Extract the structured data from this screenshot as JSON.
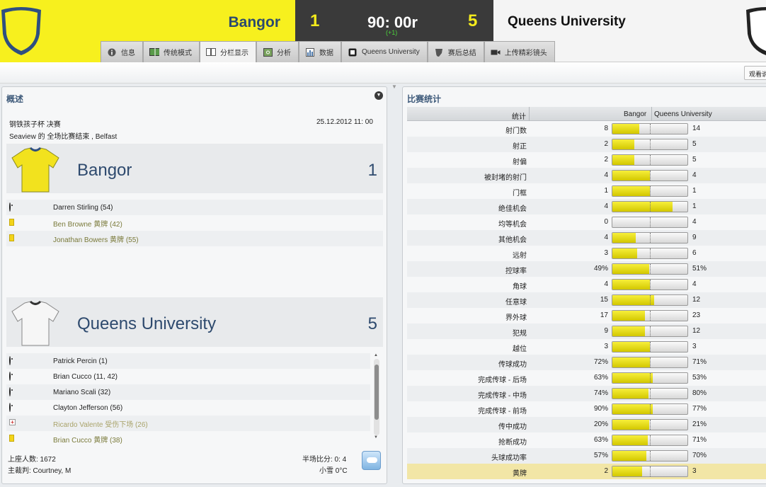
{
  "header": {
    "home_name": "Bangor",
    "away_name": "Queens University",
    "home_score": "1",
    "away_score": "5",
    "time": "90: 00r",
    "added_time": "(+1)",
    "home_color": "#f7f01e",
    "away_color": "#f4f4f4"
  },
  "tabs": [
    {
      "label": "信息",
      "icon": "info-icon"
    },
    {
      "label": "传统模式",
      "icon": "pitch-icon"
    },
    {
      "label": "分栏显示",
      "icon": "split-view-icon",
      "active": true
    },
    {
      "label": "分析",
      "icon": "analysis-icon"
    },
    {
      "label": "数据",
      "icon": "stats-icon"
    },
    {
      "label": "Queens University",
      "icon": "team-icon"
    },
    {
      "label": "赛后总结",
      "icon": "shield-icon"
    },
    {
      "label": "上传精彩镜头",
      "icon": "camera-icon"
    }
  ],
  "subbar": {
    "watch_label": "观看说"
  },
  "overview": {
    "title": "概述",
    "competition": "钢铁孩子杯 决赛",
    "date": "25.12.2012 11: 00",
    "result_line": "Seaview 的 全场比赛结束 , Belfast",
    "home": {
      "name": "Bangor",
      "goals": "1",
      "events": [
        {
          "type": "goal",
          "text": "Darren Stirling (54)"
        },
        {
          "type": "yellow",
          "text": "Ben Browne 黄牌 (42)"
        },
        {
          "type": "yellow",
          "text": "Jonathan Bowers 黄牌 (55)"
        }
      ]
    },
    "away": {
      "name": "Queens University",
      "goals": "5",
      "events": [
        {
          "type": "goal",
          "text": "Patrick Percin (1)"
        },
        {
          "type": "goal",
          "text": "Brian Cucco (11, 42)"
        },
        {
          "type": "goal",
          "text": "Mariano Scali (32)"
        },
        {
          "type": "goal",
          "text": "Clayton Jefferson (56)"
        },
        {
          "type": "injury",
          "text": "Ricardo Valente 受伤下场 (26)"
        },
        {
          "type": "yellow",
          "text": "Brian Cucco 黄牌 (38)"
        }
      ]
    },
    "attendance": "上座人数: 1672",
    "referee": "主裁判: Courtney, M",
    "halftime": "半场比分: 0: 4",
    "weather": "小雪 0°C"
  },
  "stats": {
    "title": "比赛统计",
    "col_stat": "统计",
    "col_home": "Bangor",
    "col_away": "Queens University",
    "rows": [
      {
        "label": "射门数",
        "home": "8",
        "away": "14",
        "share": 0.36
      },
      {
        "label": "射正",
        "home": "2",
        "away": "5",
        "share": 0.29
      },
      {
        "label": "射偏",
        "home": "2",
        "away": "5",
        "share": 0.29
      },
      {
        "label": "被封堵的射门",
        "home": "4",
        "away": "4",
        "share": 0.5
      },
      {
        "label": "门框",
        "home": "1",
        "away": "1",
        "share": 0.5
      },
      {
        "label": "绝佳机会",
        "home": "4",
        "away": "1",
        "share": 0.8
      },
      {
        "label": "均等机会",
        "home": "0",
        "away": "4",
        "share": 0.0
      },
      {
        "label": "其他机会",
        "home": "4",
        "away": "9",
        "share": 0.31
      },
      {
        "label": "远射",
        "home": "3",
        "away": "6",
        "share": 0.33
      },
      {
        "label": "控球率",
        "home": "49%",
        "away": "51%",
        "share": 0.49
      },
      {
        "label": "角球",
        "home": "4",
        "away": "4",
        "share": 0.5
      },
      {
        "label": "任意球",
        "home": "15",
        "away": "12",
        "share": 0.56
      },
      {
        "label": "界外球",
        "home": "17",
        "away": "23",
        "share": 0.43
      },
      {
        "label": "犯规",
        "home": "9",
        "away": "12",
        "share": 0.43
      },
      {
        "label": "越位",
        "home": "3",
        "away": "3",
        "share": 0.5
      },
      {
        "label": "传球成功",
        "home": "72%",
        "away": "71%",
        "share": 0.5
      },
      {
        "label": "完成传球 - 后场",
        "home": "63%",
        "away": "53%",
        "share": 0.54
      },
      {
        "label": "完成传球 - 中场",
        "home": "74%",
        "away": "80%",
        "share": 0.48
      },
      {
        "label": "完成传球 - 前场",
        "home": "90%",
        "away": "77%",
        "share": 0.54
      },
      {
        "label": "传中成功",
        "home": "20%",
        "away": "21%",
        "share": 0.49
      },
      {
        "label": "抢断成功",
        "home": "63%",
        "away": "71%",
        "share": 0.47
      },
      {
        "label": "头球成功率",
        "home": "57%",
        "away": "70%",
        "share": 0.45
      },
      {
        "label": "黄牌",
        "home": "2",
        "away": "3",
        "share": 0.4,
        "highlight": true
      }
    ]
  }
}
